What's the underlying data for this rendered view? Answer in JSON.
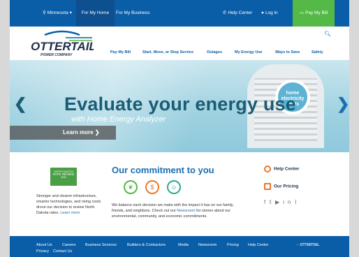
{
  "topbar": {
    "region": "Minnesota",
    "home": "For My Home",
    "business": "For My Business",
    "help": "Help Center",
    "login": "Log in",
    "pay": "Pay My Bill"
  },
  "logo": {
    "name": "OTTERTAIL",
    "sub": "POWER COMPANY"
  },
  "nav": {
    "items": [
      "Pay My Bill",
      "Start, Move, or Stop Service",
      "Outages",
      "My Energy Use",
      "Ways to Save",
      "Safety"
    ]
  },
  "hero": {
    "title": "Evaluate your energy use",
    "subtitle": "with Home Energy Analyzer",
    "cta": "Learn more",
    "badge_line1": "home",
    "badge_line2": "electricity",
    "badge_line3": "costs"
  },
  "rate": {
    "logo_line1": "NORTH DAKOTA",
    "logo_line2": "RATE REVIEW",
    "logo_line3": "2020",
    "text": "Stronger and cleaner infrastructure, smarter technologies, and rising costs drove our decision to review North Dakota rates.",
    "link": "Learn more"
  },
  "commitment": {
    "title": "Our commitment to you",
    "text_before": "We balance each decision we make with the impact it has on our family, friends, and neighbors. Check out our ",
    "link": "Newsroom",
    "text_after": " for stories about our environmental, community, and economic commitments."
  },
  "side": {
    "help_center": "Help Center",
    "pricing": "Our Pricing"
  },
  "footer": {
    "row1": [
      "About Us",
      "Careers",
      "Business Services",
      "Builders & Contractors",
      "Media",
      "Newsroom",
      "Pricing",
      "Help Center"
    ],
    "row2": [
      "Privacy",
      "Contact Us"
    ],
    "logo_text": "OTTERTAIL"
  },
  "colors": {
    "brand_blue": "#0a5ea8",
    "pay_green": "#55b947",
    "hero_title": "#1b5c75"
  }
}
